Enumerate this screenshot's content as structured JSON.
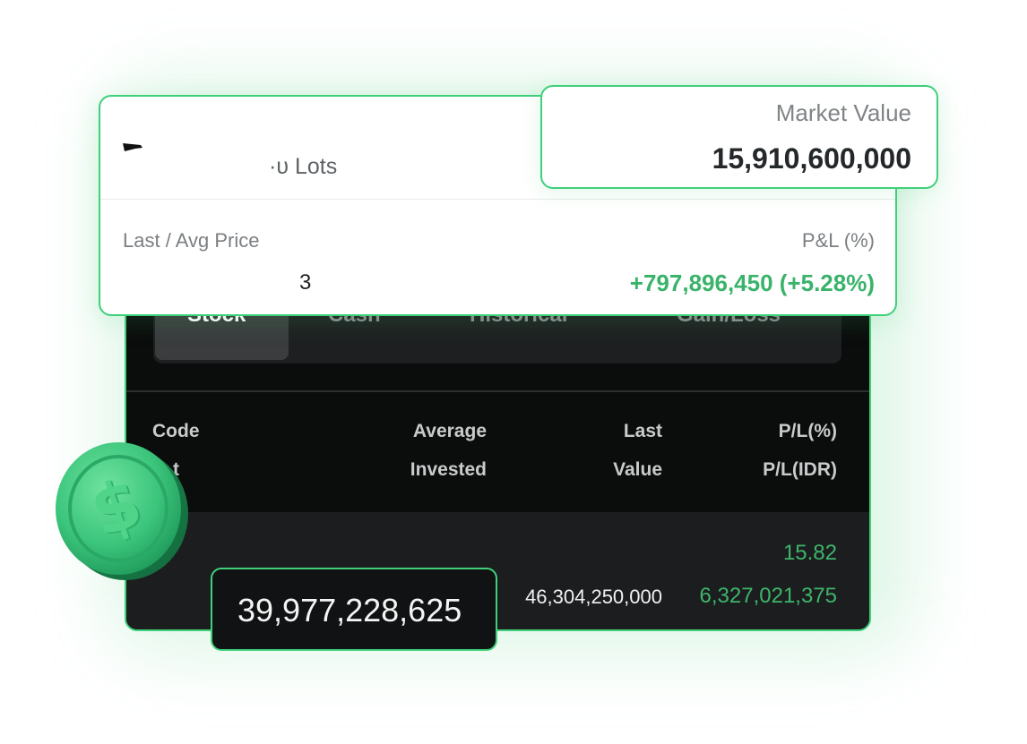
{
  "top_card": {
    "lots_text": "·υ Lots",
    "last_avg_label": "Last / Avg Price",
    "pl_label": "P&L (%)",
    "price_fragment": "3",
    "pl_value": "+797,896,450 (+5.28%)"
  },
  "market_value": {
    "label": "Market Value",
    "value": "15,910,600,000"
  },
  "tabs": [
    {
      "label": "Stock",
      "active": true
    },
    {
      "label": "Cash",
      "active": false
    },
    {
      "label": "Historical",
      "active": false
    },
    {
      "label": "Gain/Loss",
      "active": false
    }
  ],
  "table": {
    "headers": {
      "code": "Code",
      "code_sub": "t",
      "average": "Average",
      "invested": "Invested",
      "last": "Last",
      "value": "Value",
      "pl_pct": "P/L(%)",
      "pl_idr": "P/L(IDR)"
    },
    "row": {
      "pl_pct": "15.82",
      "value": "46,304,250,000",
      "pl_idr": "6,327,021,375"
    }
  },
  "invested_callout": {
    "value": "39,977,228,625"
  },
  "colors": {
    "accent_green": "#3fd07a",
    "gain_green": "#3db56a",
    "dark_bg": "#0b0c0c"
  },
  "icons": {
    "coin": "dollar-coin-icon",
    "flag": "flag-icon"
  }
}
